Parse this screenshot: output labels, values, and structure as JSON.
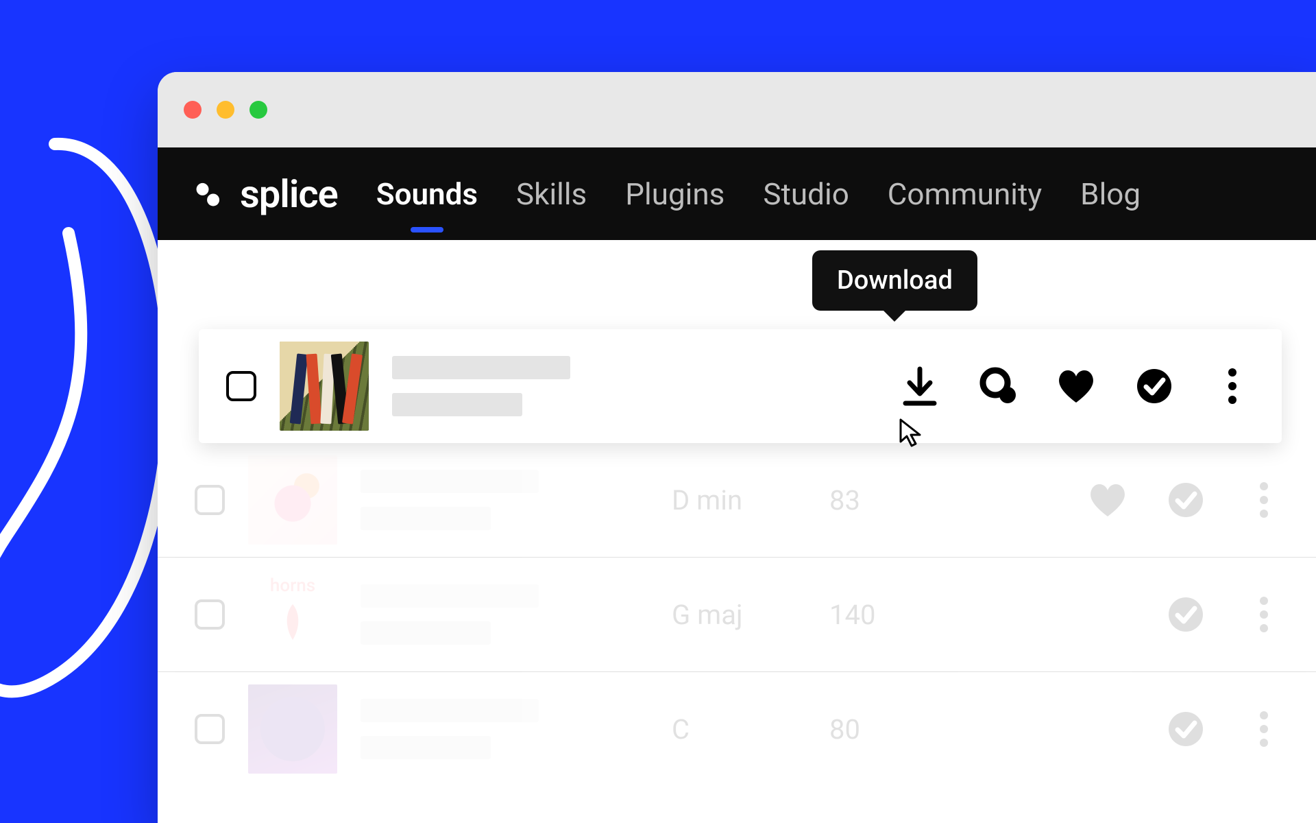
{
  "brand": "splice",
  "nav": {
    "items": [
      "Sounds",
      "Skills",
      "Plugins",
      "Studio",
      "Community",
      "Blog"
    ],
    "activeIndex": 0
  },
  "tooltip": "Download",
  "rows": [
    {
      "key": "",
      "bpm": ""
    },
    {
      "key": "D min",
      "bpm": "83"
    },
    {
      "key": "G maj",
      "bpm": "140"
    },
    {
      "key": "C",
      "bpm": "80"
    }
  ],
  "art3_label": "horns"
}
